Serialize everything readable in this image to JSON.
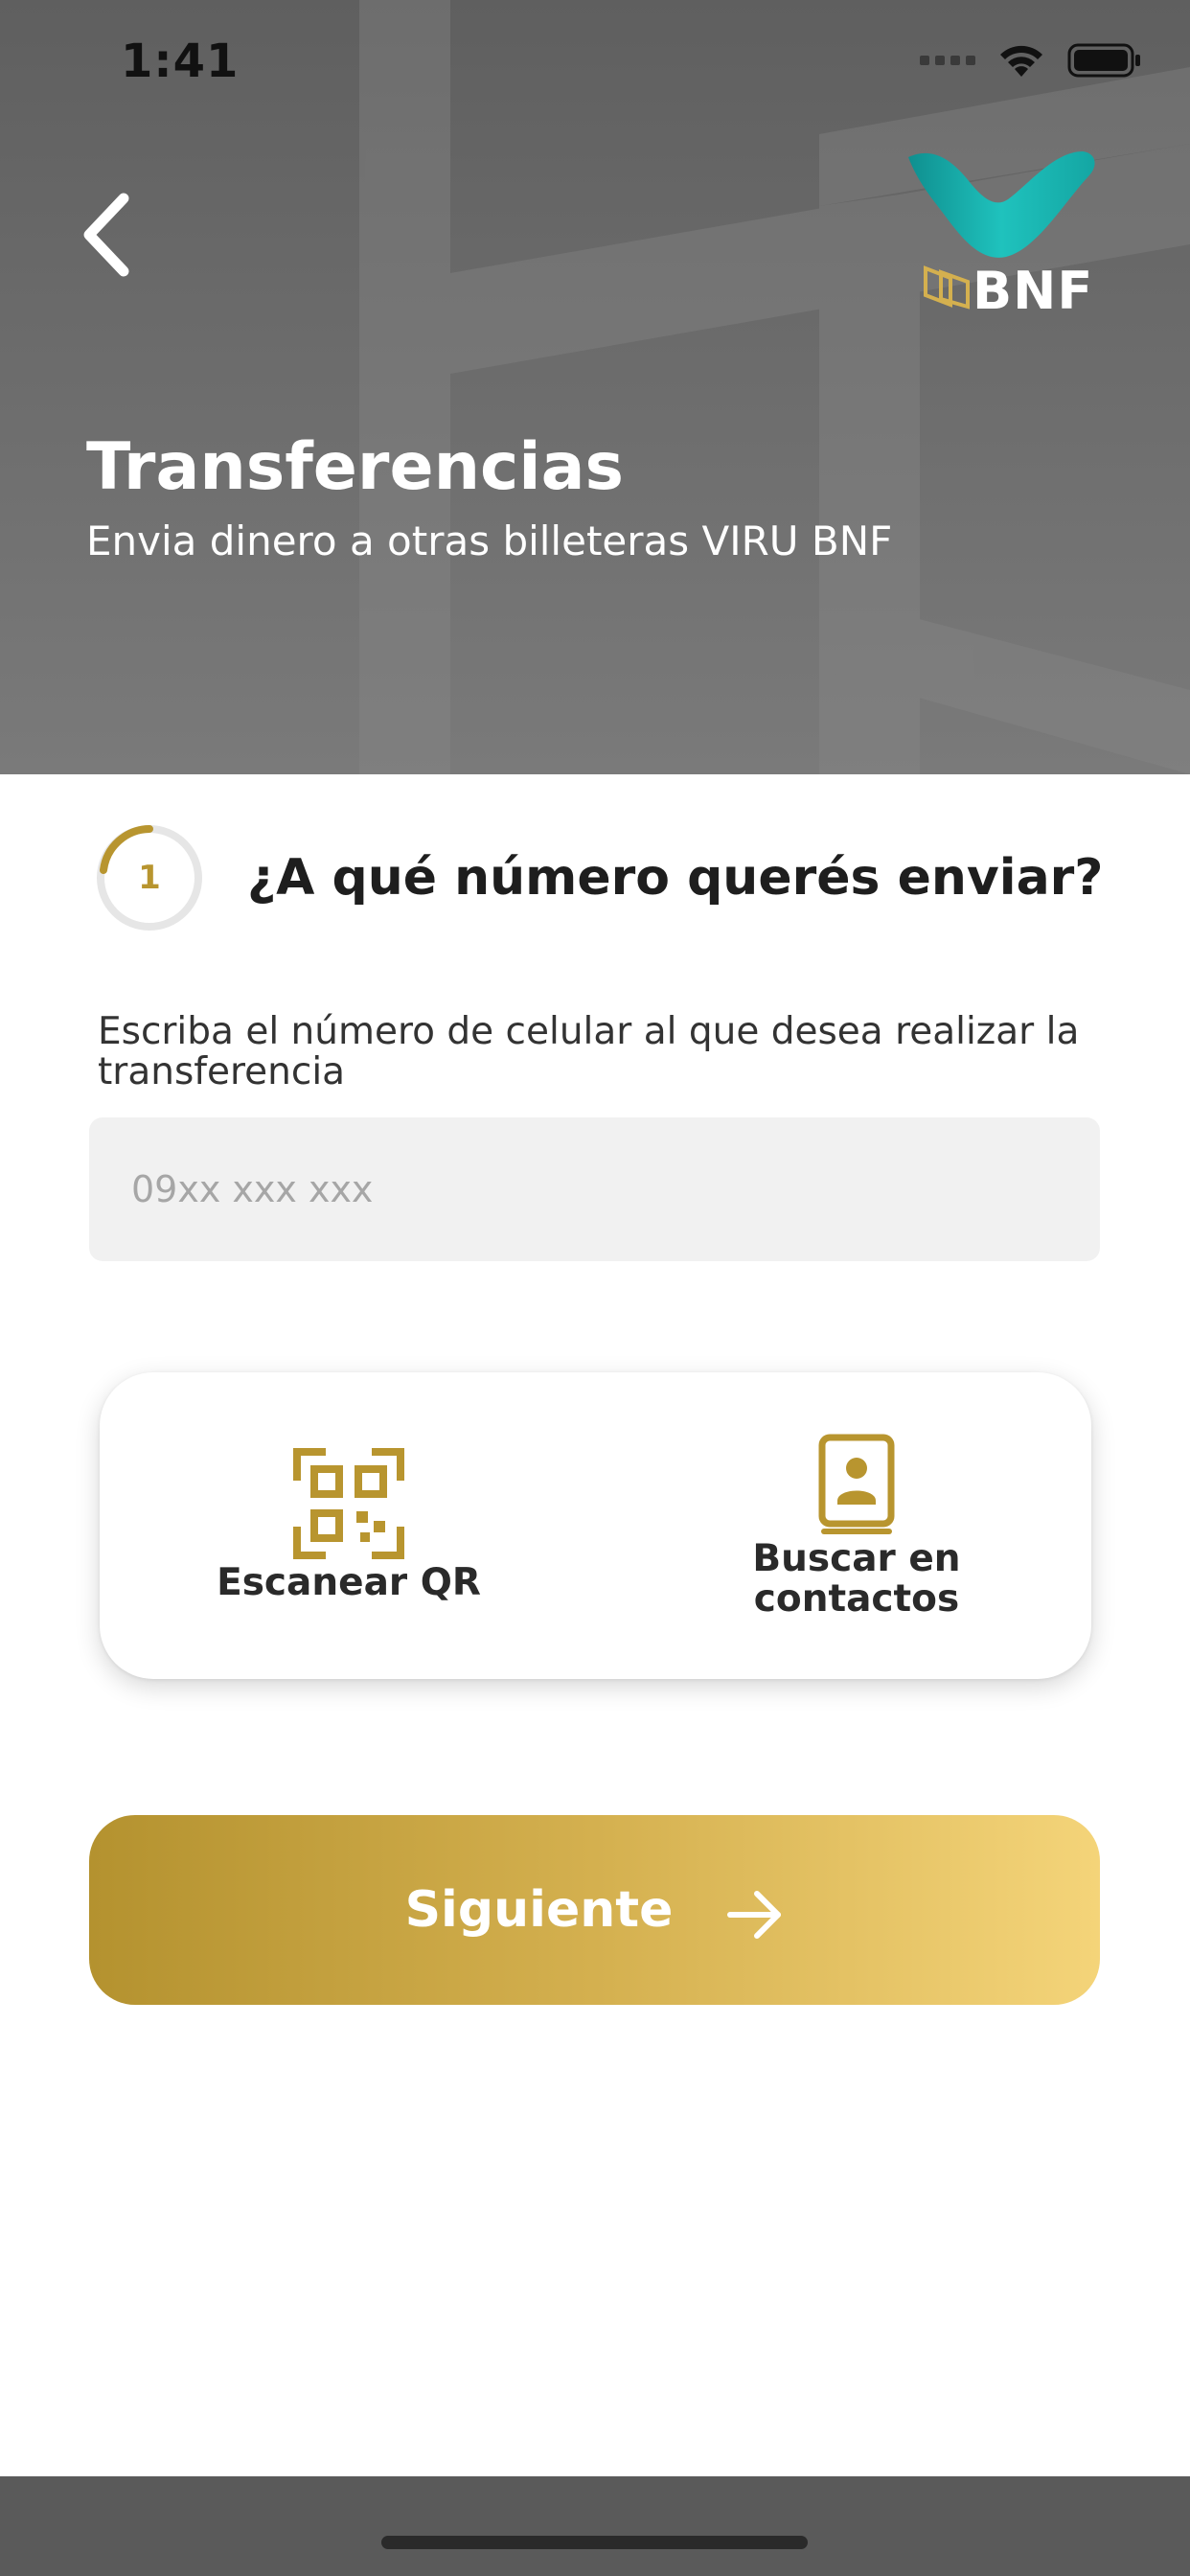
{
  "status_bar": {
    "time": "1:41",
    "icons": [
      "signal-dots-icon",
      "wifi-icon",
      "battery-icon"
    ]
  },
  "header": {
    "back_icon": "chevron-left-icon",
    "logo_text": "BNF",
    "title": "Transferencias",
    "subtitle": "Envia dinero a otras billeteras VIRU BNF"
  },
  "step": {
    "number": "1",
    "question": "¿A qué número querés enviar?"
  },
  "form": {
    "label": "Escriba el número de celular al que desea realizar la transferencia",
    "phone_placeholder": "09xx xxx xxx",
    "phone_value": ""
  },
  "actions": {
    "scan_qr_label": "Escanear QR",
    "scan_qr_icon": "qr-code-icon",
    "contacts_label_line1": "Buscar en",
    "contacts_label_line2": "contactos",
    "contacts_icon": "contact-book-icon"
  },
  "next_button": {
    "label": "Siguiente",
    "icon": "arrow-right-icon"
  },
  "colors": {
    "accent_gold": "#b8952f",
    "gold_light": "#f4d479",
    "header_gray": "#6a6a6a",
    "teal_logo": "#1aa6a6",
    "input_bg": "#f1f1f1"
  }
}
